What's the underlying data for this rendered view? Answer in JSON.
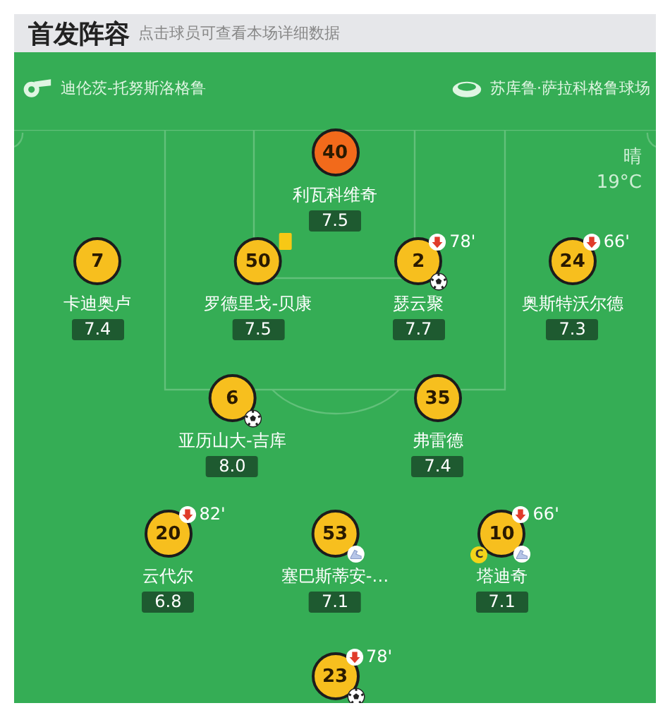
{
  "header": {
    "title": "首发阵容",
    "hint": "点击球员可查看本场详细数据"
  },
  "team": {
    "coach": "迪伦茨-托努斯洛格鲁",
    "stadium": "苏库鲁·萨拉科格鲁球场"
  },
  "weather": {
    "condition": "晴",
    "temperature": "19°C"
  },
  "lines": [
    [
      {
        "number": "40",
        "name": "利瓦科维奇",
        "rating": "7.5",
        "color": "#f26a1b",
        "yellow_card": false,
        "goal": false,
        "assist": false
      }
    ],
    [
      {
        "number": "7",
        "name": "卡迪奥卢",
        "rating": "7.4",
        "color": "#f7bf1e",
        "yellow_card": false,
        "goal": false,
        "assist": false
      },
      {
        "number": "50",
        "name": "罗德里戈-贝康",
        "rating": "7.5",
        "color": "#f7bf1e",
        "yellow_card": true,
        "goal": false,
        "assist": false
      },
      {
        "number": "2",
        "name": "瑟云聚",
        "rating": "7.7",
        "color": "#f7bf1e",
        "yellow_card": false,
        "sub_minute": "78'",
        "goal": true,
        "assist": false
      },
      {
        "number": "24",
        "name": "奥斯特沃尔德",
        "rating": "7.3",
        "color": "#f7bf1e",
        "yellow_card": false,
        "sub_minute": "66'",
        "goal": false,
        "assist": false
      }
    ],
    [
      {
        "number": "6",
        "name": "亚历山大-吉库",
        "rating": "8.0",
        "color": "#f7bf1e",
        "yellow_card": false,
        "goal": true,
        "assist": false
      },
      {
        "number": "35",
        "name": "弗雷德",
        "rating": "7.4",
        "color": "#f7bf1e",
        "yellow_card": false,
        "goal": false,
        "assist": false
      }
    ],
    [
      {
        "number": "20",
        "name": "云代尔",
        "rating": "6.8",
        "color": "#f7bf1e",
        "yellow_card": false,
        "sub_minute": "82'",
        "goal": false,
        "assist": false
      },
      {
        "number": "53",
        "name": "塞巴斯蒂安-…",
        "rating": "7.1",
        "color": "#f7bf1e",
        "yellow_card": false,
        "goal": false,
        "assist": true
      },
      {
        "number": "10",
        "name": "塔迪奇",
        "rating": "7.1",
        "color": "#f7bf1e",
        "yellow_card": false,
        "sub_minute": "66'",
        "goal": false,
        "assist": true,
        "captain_label": "C"
      }
    ],
    [
      {
        "number": "23",
        "color": "#f7bf1e",
        "yellow_card": false,
        "sub_minute": "78'",
        "goal": true,
        "assist": false
      }
    ]
  ]
}
